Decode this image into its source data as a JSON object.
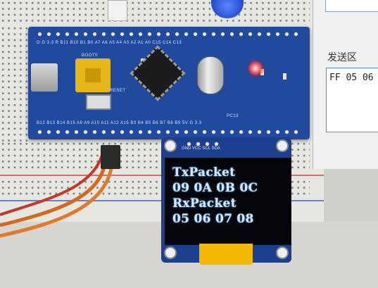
{
  "board": {
    "top_silk": "G G 3.3 R B11 B10 B1 B0 A7 A6 A5 A4 A3 A2 A1 A0 C15 C14 C13",
    "bottom_silk": "B12 B13 B14 B15 A8 A9 A10 A11 A12 A15 B3 B4 B5 B6 B7 B8 B9 5V G 3.3",
    "jumper_label": "BOOT0",
    "reset_label": "RESET",
    "pc13_label": "PC13"
  },
  "oled": {
    "pin_labels": "GND VCC SCL SDA",
    "lines": [
      "TxPacket",
      "09 0A 0B 0C",
      "RxPacket",
      "05 06 07 08"
    ]
  },
  "pc_window": {
    "send_area_label": "发送区",
    "send_area_value": "FF 05 06"
  },
  "colors": {
    "board_blue": "#1f4a9e",
    "oled_text": "#cfe7ff",
    "led_red": "#ff2a2a"
  }
}
